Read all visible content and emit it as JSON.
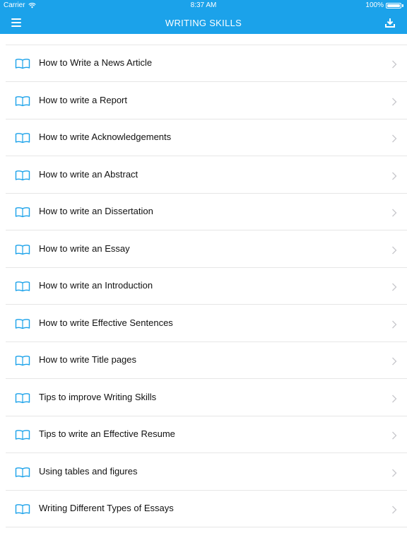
{
  "statusbar": {
    "carrier": "Carrier",
    "time": "8:37 AM",
    "battery": "100%"
  },
  "navbar": {
    "title": "WRITING SKILLS",
    "left_icon": "menu-icon",
    "right_icon": "download-icon",
    "color": "#1ba2ea"
  },
  "list": {
    "item_icon": "book-icon",
    "accessory_icon": "chevron-right-icon",
    "icon_color": "#1ba2ea",
    "items": [
      {
        "label": "How to Write a News Article"
      },
      {
        "label": "How to write a Report"
      },
      {
        "label": "How to write Acknowledgements"
      },
      {
        "label": "How to write an Abstract"
      },
      {
        "label": "How to write an Dissertation"
      },
      {
        "label": "How to write an Essay"
      },
      {
        "label": "How to write an Introduction"
      },
      {
        "label": "How to write Effective Sentences"
      },
      {
        "label": "How to write Title pages"
      },
      {
        "label": "Tips to improve Writing Skills"
      },
      {
        "label": "Tips to write an Effective Resume"
      },
      {
        "label": "Using tables and figures"
      },
      {
        "label": "Writing Different Types of Essays"
      }
    ]
  }
}
